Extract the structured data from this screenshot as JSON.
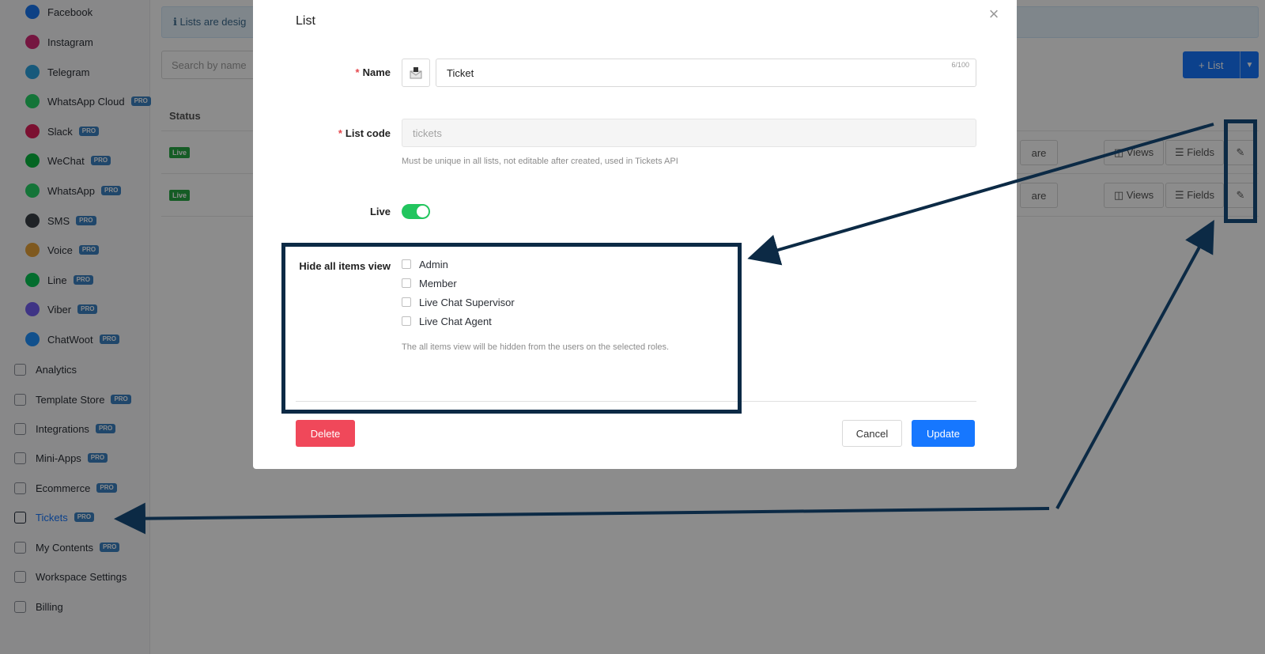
{
  "sidebar": {
    "channels": [
      {
        "label": "Facebook",
        "icon": "facebook-messenger-icon",
        "color": "#1877f2",
        "pro": false
      },
      {
        "label": "Instagram",
        "icon": "instagram-icon",
        "color": "#d62976",
        "pro": false
      },
      {
        "label": "Telegram",
        "icon": "telegram-icon",
        "color": "#2aa3e0",
        "pro": false
      },
      {
        "label": "WhatsApp Cloud",
        "icon": "whatsapp-icon",
        "color": "#25d366",
        "pro": true
      },
      {
        "label": "Slack",
        "icon": "slack-icon",
        "color": "#e01e5a",
        "pro": true
      },
      {
        "label": "WeChat",
        "icon": "wechat-icon",
        "color": "#09b83e",
        "pro": true
      },
      {
        "label": "WhatsApp",
        "icon": "whatsapp-icon",
        "color": "#25d366",
        "pro": true
      },
      {
        "label": "SMS",
        "icon": "sms-icon",
        "color": "#3a3f46",
        "pro": true
      },
      {
        "label": "Voice",
        "icon": "phone-icon",
        "color": "#e8a33a",
        "pro": true
      },
      {
        "label": "Line",
        "icon": "line-icon",
        "color": "#06c755",
        "pro": true
      },
      {
        "label": "Viber",
        "icon": "viber-icon",
        "color": "#7360f2",
        "pro": true
      },
      {
        "label": "ChatWoot",
        "icon": "chatwoot-icon",
        "color": "#1f93ff",
        "pro": true
      }
    ],
    "sections": [
      {
        "label": "Analytics",
        "icon": "analytics-icon",
        "pro": false,
        "active": false
      },
      {
        "label": "Template Store",
        "icon": "template-store-icon",
        "pro": true,
        "active": false
      },
      {
        "label": "Integrations",
        "icon": "integrations-icon",
        "pro": true,
        "active": false
      },
      {
        "label": "Mini-Apps",
        "icon": "mini-apps-icon",
        "pro": true,
        "active": false
      },
      {
        "label": "Ecommerce",
        "icon": "cart-icon",
        "pro": true,
        "active": false
      },
      {
        "label": "Tickets",
        "icon": "tickets-icon",
        "pro": true,
        "active": true
      },
      {
        "label": "My Contents",
        "icon": "document-icon",
        "pro": true,
        "active": false
      },
      {
        "label": "Workspace Settings",
        "icon": "gear-icon",
        "pro": false,
        "active": false
      },
      {
        "label": "Billing",
        "icon": "credit-card-icon",
        "pro": false,
        "active": false
      }
    ],
    "pro_label": "PRO"
  },
  "page": {
    "banner": "ℹ Lists are desig",
    "search_placeholder": "Search by name",
    "add_list_label": "+ List",
    "table_status_header": "Status",
    "rows": [
      {
        "status": "Live",
        "share_label": "are",
        "views_label": "Views",
        "fields_label": "Fields"
      },
      {
        "status": "Live",
        "share_label": "are",
        "views_label": "Views",
        "fields_label": "Fields"
      }
    ]
  },
  "modal": {
    "title": "List",
    "name_label": "Name",
    "name_value": "Ticket",
    "name_count": "6/100",
    "code_label": "List code",
    "code_value": "tickets",
    "code_help": "Must be unique in all lists, not editable after created, used in Tickets API",
    "live_label": "Live",
    "live_on": true,
    "hide_label": "Hide all items view",
    "roles": [
      "Admin",
      "Member",
      "Live Chat Supervisor",
      "Live Chat Agent"
    ],
    "hide_help": "The all items view will be hidden from the users on the selected roles.",
    "delete_label": "Delete",
    "cancel_label": "Cancel",
    "update_label": "Update"
  },
  "colors": {
    "accent": "#1677ff",
    "danger": "#f0485a",
    "toggle_on": "#22c55e",
    "annotation": "#0c2a45"
  }
}
